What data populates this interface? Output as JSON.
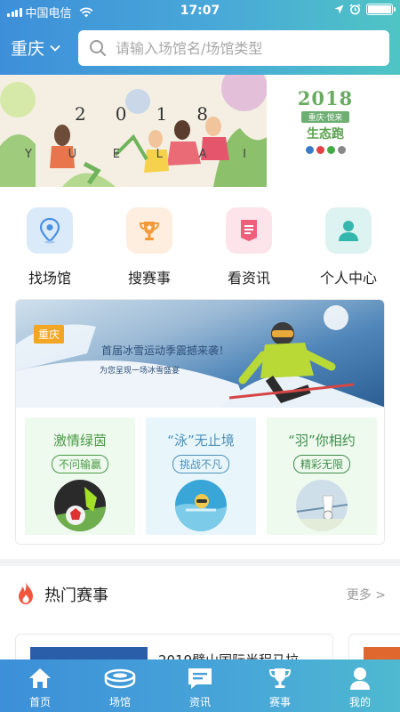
{
  "status_bar": {
    "carrier": "中国电信",
    "time": "17:07"
  },
  "header": {
    "city": "重庆",
    "search_placeholder": "请输入场馆名/场馆类型"
  },
  "banner": {
    "main_digits": [
      "2",
      "0",
      "1",
      "8"
    ],
    "main_letters": [
      "Y",
      "U",
      "E",
      "L",
      "A",
      "I"
    ],
    "side_year": "2018",
    "side_tag": "重庆·悦来",
    "side_title": "生态跑"
  },
  "quick_links": [
    {
      "label": "找场馆",
      "icon": "location-pin-icon",
      "bg": "#dbeaf9",
      "color": "#4a90e2"
    },
    {
      "label": "搜赛事",
      "icon": "trophy-icon",
      "bg": "#fdeee0",
      "color": "#f29a3a"
    },
    {
      "label": "看资讯",
      "icon": "news-icon",
      "bg": "#fce4ea",
      "color": "#ee5f7c"
    },
    {
      "label": "个人中心",
      "icon": "person-icon",
      "bg": "#ddf3f1",
      "color": "#35b7ad"
    }
  ],
  "promo": {
    "tag": "重庆",
    "title": "首届冰雪运动季震撼来袭！",
    "subtitle": "为您呈现一场冰雪盛宴"
  },
  "category_tiles": [
    {
      "title": "激情绿茵",
      "pill": "不问输赢",
      "bg": "#effaef",
      "title_color": "#4a9a45",
      "pill_color": "#4a9a45",
      "icon": "soccer-ball-icon"
    },
    {
      "title": "“泳”无止境",
      "pill": "挑战不凡",
      "bg": "#e8f6fc",
      "title_color": "#4a8fb8",
      "pill_color": "#4a8fb8",
      "icon": "swimmer-icon"
    },
    {
      "title": "“羽”你相约",
      "pill": "精彩无限",
      "bg": "#effaef",
      "title_color": "#3f8d4a",
      "pill_color": "#3f8d4a",
      "icon": "shuttlecock-icon"
    }
  ],
  "hot_section": {
    "title": "热门赛事",
    "more": "更多 >"
  },
  "events": [
    {
      "title": "2019璧山国际半程马拉"
    }
  ],
  "tab_bar": [
    {
      "label": "首页",
      "icon": "home-icon"
    },
    {
      "label": "场馆",
      "icon": "stadium-icon"
    },
    {
      "label": "资讯",
      "icon": "chat-news-icon"
    },
    {
      "label": "赛事",
      "icon": "trophy-icon"
    },
    {
      "label": "我的",
      "icon": "user-icon"
    }
  ],
  "colors": {
    "primary": "#3d8fd9",
    "secondary": "#4fc4c4",
    "accent_orange": "#f3a623",
    "fire": "#f0563e"
  }
}
